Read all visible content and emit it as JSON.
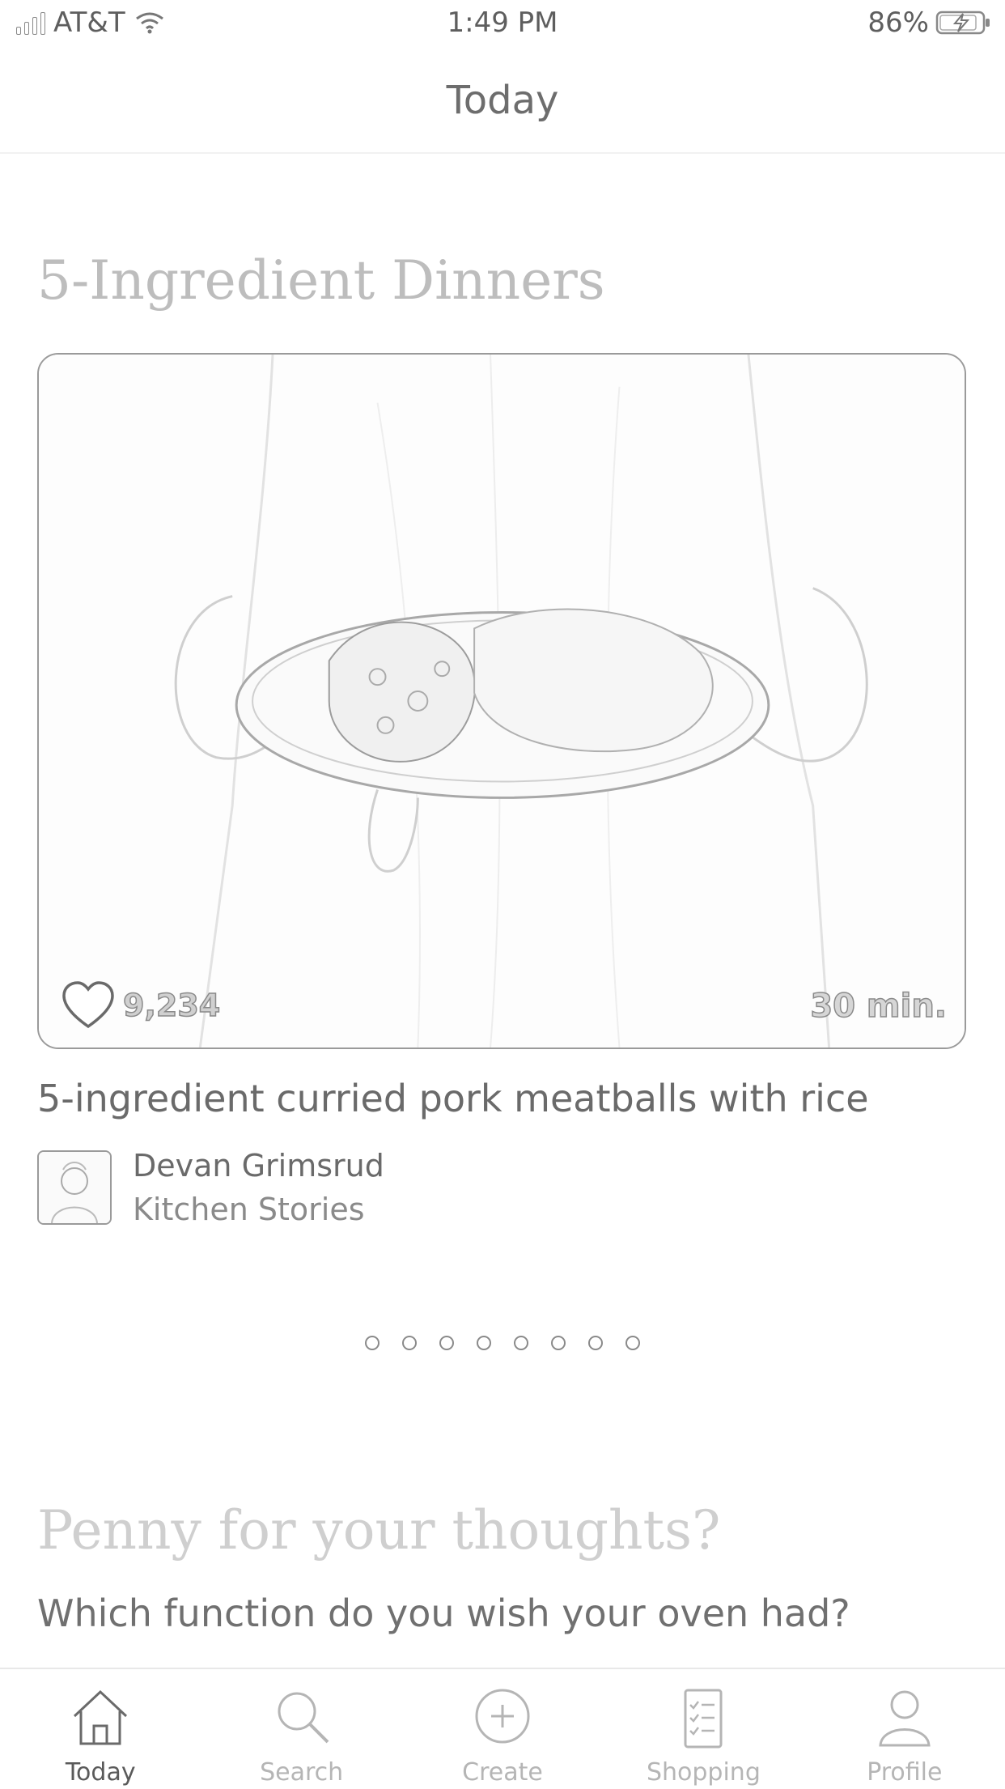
{
  "status_bar": {
    "carrier": "AT&T",
    "time": "1:49 PM",
    "battery": "86%"
  },
  "navbar": {
    "title": "Today"
  },
  "featured_section": {
    "title": "5-Ingredient Dinners",
    "recipe": {
      "likes": "9,234",
      "duration": "30 min.",
      "title": "5-ingredient curried pork meatballs with rice",
      "author_name": "Devan Grimsrud",
      "author_source": "Kitchen Stories"
    },
    "carousel_pages": 8,
    "carousel_active": 0
  },
  "poll": {
    "title": "Penny for your thoughts?",
    "question": "Which function do you wish your oven had?"
  },
  "tabbar": {
    "items": [
      {
        "label": "Today",
        "icon": "home-icon",
        "active": true
      },
      {
        "label": "Search",
        "icon": "search-icon",
        "active": false
      },
      {
        "label": "Create",
        "icon": "plus-circle-icon",
        "active": false
      },
      {
        "label": "Shopping",
        "icon": "shopping-list-icon",
        "active": false
      },
      {
        "label": "Profile",
        "icon": "profile-icon",
        "active": false
      }
    ]
  }
}
